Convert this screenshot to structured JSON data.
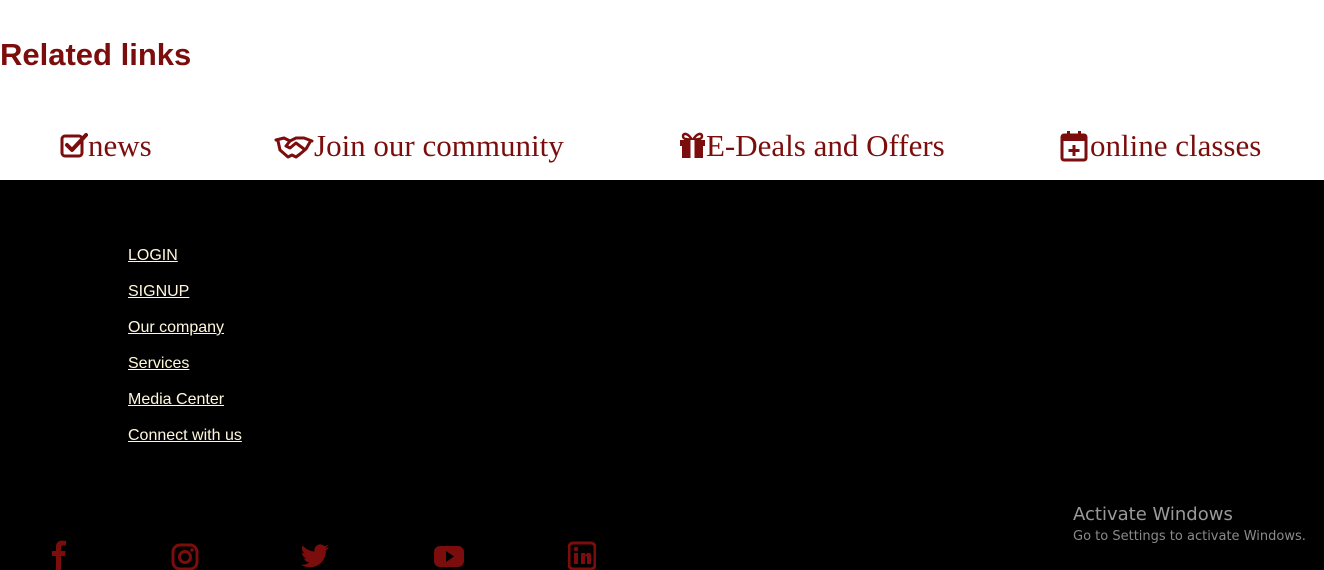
{
  "related": {
    "title": "Related links",
    "links": [
      {
        "label": "news",
        "icon": "check-square-icon"
      },
      {
        "label": "Join our community",
        "icon": "handshake-icon"
      },
      {
        "label": "E-Deals and Offers",
        "icon": "gift-icon"
      },
      {
        "label": "online classes",
        "icon": "calendar-plus-icon"
      }
    ]
  },
  "footer": {
    "links": [
      "LOGIN",
      "SIGNUP",
      "Our company",
      "Services",
      "Media Center",
      "Connect with us"
    ],
    "social": [
      "facebook-icon",
      "instagram-icon",
      "twitter-icon",
      "youtube-icon",
      "linkedin-icon"
    ]
  },
  "watermark": {
    "title": "Activate Windows",
    "subtitle": "Go to Settings to activate Windows."
  },
  "colors": {
    "brand": "#7b0d0d",
    "footer_bg": "#000000",
    "footer_link": "#fff8dc"
  }
}
